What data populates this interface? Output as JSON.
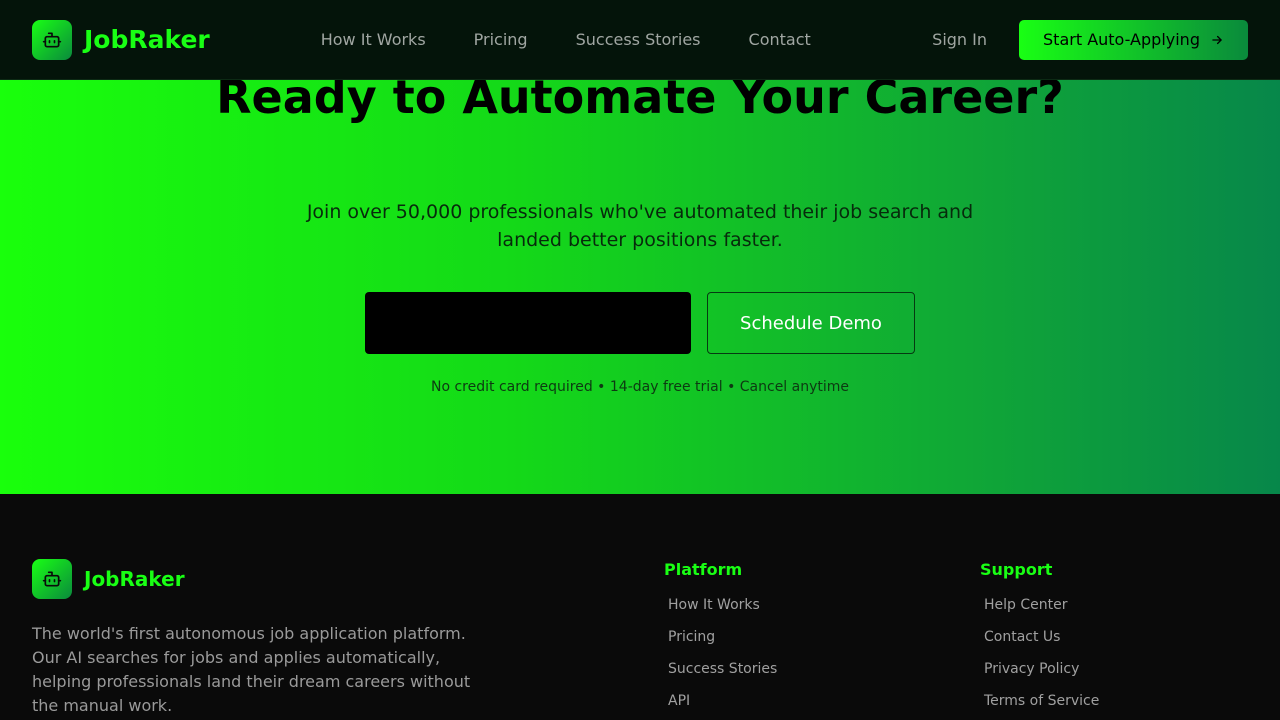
{
  "brand": {
    "name": "JobRaker",
    "icon": "robot-icon",
    "accent": "#19ff14"
  },
  "nav": {
    "links": [
      "How It Works",
      "Pricing",
      "Success Stories",
      "Contact"
    ],
    "signin": "Sign In",
    "cta": "Start Auto-Applying",
    "cta_icon": "arrow-right-icon"
  },
  "hero": {
    "title": "Ready to Automate Your Career?",
    "subtitle": "Join over 50,000 professionals who've automated their job search and landed better positions faster.",
    "demo_button": "Schedule Demo",
    "note": "No credit card required • 14-day free trial • Cancel anytime"
  },
  "footer": {
    "description": "The world's first autonomous job application platform. Our AI searches for jobs and applies automatically, helping professionals land their dream careers without the manual work.",
    "platform": {
      "title": "Platform",
      "links": [
        "How It Works",
        "Pricing",
        "Success Stories",
        "API"
      ]
    },
    "support": {
      "title": "Support",
      "links": [
        "Help Center",
        "Contact Us",
        "Privacy Policy",
        "Terms of Service"
      ]
    }
  }
}
